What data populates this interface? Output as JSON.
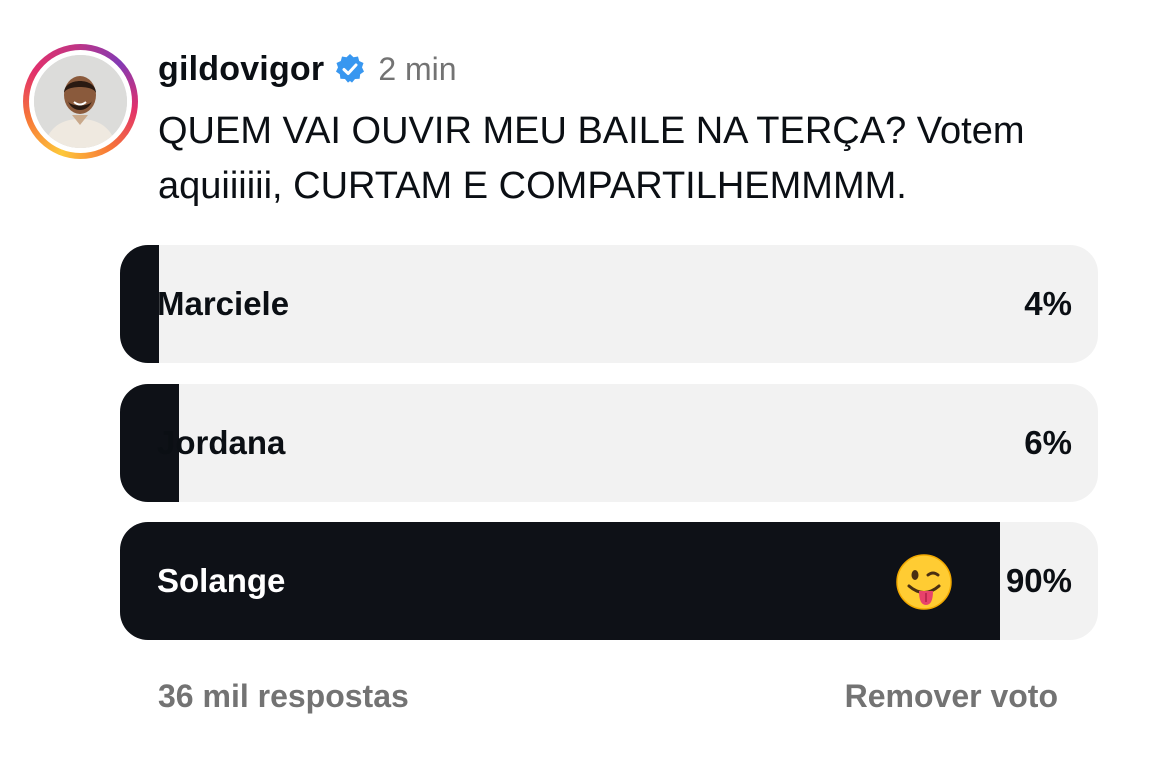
{
  "post": {
    "username": "gildovigor",
    "verified_icon": "verified-badge-icon",
    "time": "2 min",
    "text": "QUEM VAI OUVIR MEU BAILE NA TERÇA? Votem aquiiiiii, CURTAM E COMPARTILHEMMMM."
  },
  "poll": {
    "options": [
      {
        "label": "Marciele",
        "percent_label": "4%",
        "percent": 4
      },
      {
        "label": "Jordana",
        "percent_label": "6%",
        "percent": 6
      },
      {
        "label": "Solange",
        "percent_label": "90%",
        "percent": 90,
        "selected_emoji": "winking-face-with-tongue-icon"
      }
    ],
    "responses": "36 mil respostas",
    "remove_vote": "Remover voto"
  },
  "colors": {
    "fill": "#0e1117",
    "track": "#f2f2f2",
    "muted": "#737373",
    "verified": "#3897f0"
  }
}
